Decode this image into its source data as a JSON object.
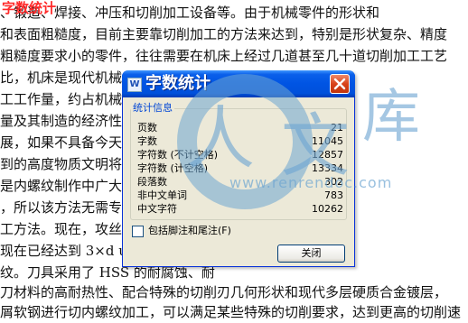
{
  "document": {
    "top_label": "字数统计",
    "lines": [
      "                    、锻造、焊接、冲压和切削加工设备等。由于机械零件的形状和",
      "和表面粗糙度，目前主要靠切削加工的方法来达到，特别是形状复杂、精度",
      "粗糙度要求小的零件，往往需要在机床上经过几道甚至几十道切削加工工艺",
      "比，机床是现代机械                                      械制造厂中，",
      "工工作量，约占机械                                      术性能直接影响",
      "量及其制造的经济性                                      可以这样说，如果",
      "展，如果不具备今天                                      的各种机床，现代",
      "到的高度物质文明将                                               ",
      "是内螺纹制作中广大                                      的几何形状确定",
      "，所以该方法无需专                                      加工中心上都可",
      "工方法。现在，攻丝                                      例如盲孔螺纹加",
      "现在已经达到 3×d                                  us 丝锥可以切削",
      "纹。刀具采用了 HSS                                  的耐腐蚀、耐",
      "刀材料的高耐热性、配合特殊的切削刃几何形状和现代多层硬质合金镀层，",
      "屑软钢进行切内螺纹加工，可以满足某些特殊的切削要求，达到更高的切削速"
    ]
  },
  "watermark": {
    "char_1": "人",
    "char_2": "文",
    "char_3": "库",
    "url": "www.renrendoc.com"
  },
  "dialog": {
    "title": "字数统计",
    "group_title": "统计信息",
    "stats": [
      {
        "label": "页数",
        "value": "21"
      },
      {
        "label": "字数",
        "value": "11045"
      },
      {
        "label": "字符数 (不计空格)",
        "value": "12857"
      },
      {
        "label": "字符数 (计空格)",
        "value": "13334"
      },
      {
        "label": "段落数",
        "value": "302"
      },
      {
        "label": "非中文单词",
        "value": "783"
      },
      {
        "label": "中文字符",
        "value": "10262"
      }
    ],
    "include_footnotes_label": "包括脚注和尾注(F)",
    "include_footnotes_checked": false,
    "close_button": "关闭"
  },
  "colors": {
    "titlebar": "#0054e3",
    "dialog_bg": "#ece9d8",
    "group_title": "#0046d5",
    "top_label": "#ff2a2a",
    "close_button": "#d8421a"
  }
}
